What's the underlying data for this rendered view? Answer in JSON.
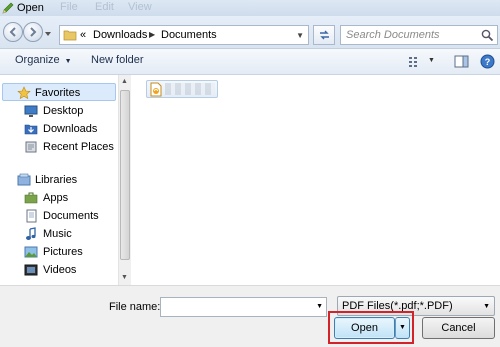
{
  "window": {
    "title": "Open",
    "ghost_menu": [
      "File",
      "Edit",
      "View"
    ]
  },
  "address": {
    "overflow": "«",
    "crumbs": [
      "Downloads",
      "Documents"
    ],
    "search_placeholder": "Search Documents"
  },
  "toolbar": {
    "organize": "Organize",
    "new_folder": "New folder"
  },
  "nav": {
    "favorites": {
      "label": "Favorites",
      "items": [
        "Desktop",
        "Downloads",
        "Recent Places"
      ]
    },
    "libraries": {
      "label": "Libraries",
      "items": [
        "Apps",
        "Documents",
        "Music",
        "Pictures",
        "Videos"
      ]
    }
  },
  "footer": {
    "file_name_label": "File name:",
    "file_name_value": "",
    "file_type": "PDF Files(*.pdf;*.PDF)",
    "open_label": "Open",
    "cancel_label": "Cancel"
  },
  "colors": {
    "accent": "#3c7fb1",
    "highlight": "#d2232a",
    "selection": "#dcebfc"
  }
}
